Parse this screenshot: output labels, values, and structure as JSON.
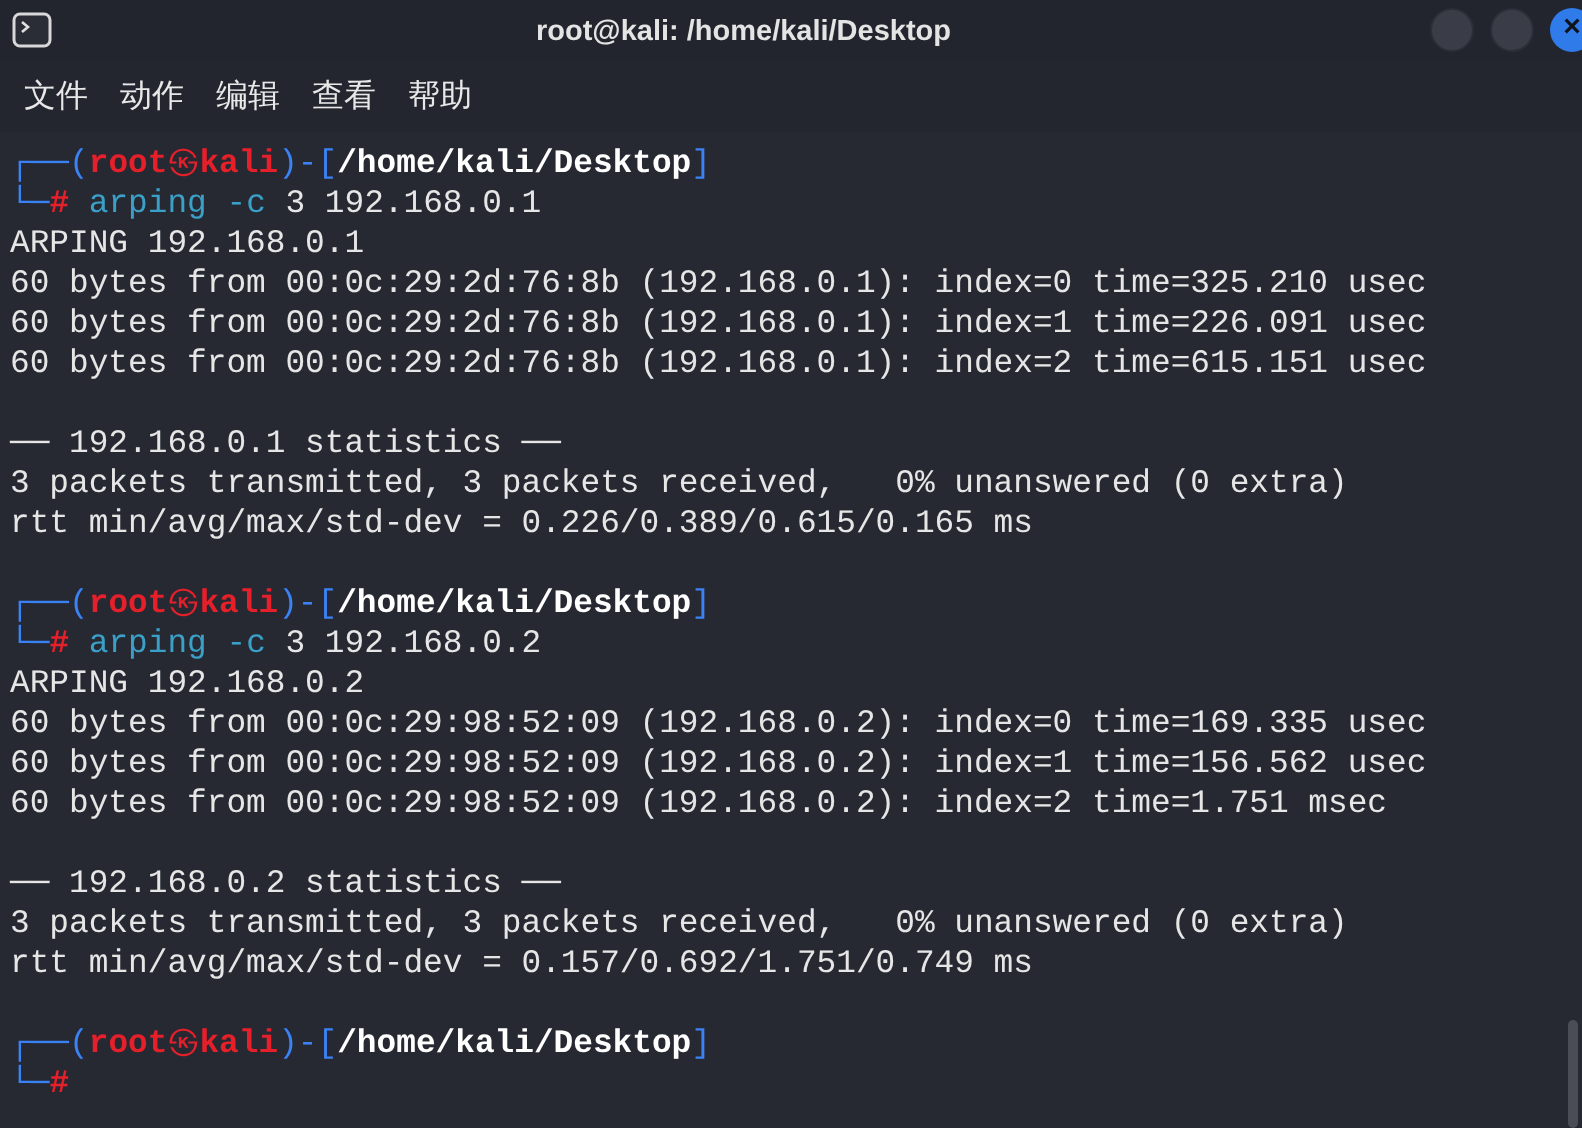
{
  "window": {
    "title": "root@kali: /home/kali/Desktop",
    "close": "×"
  },
  "menu": [
    "文件",
    "动作",
    "编辑",
    "查看",
    "帮助"
  ],
  "lines": [
    {
      "kind": "prompt",
      "open": "┌──(",
      "user": "root",
      "at": "㉿",
      "host": "kali",
      "mid": ")-[",
      "path": "/home/kali/Desktop",
      "close": "]"
    },
    {
      "kind": "command",
      "corner": "└─",
      "hash": "#",
      "program": "arping",
      "option": "-c",
      "args": "3 192.168.0.1"
    },
    {
      "kind": "output",
      "text": "ARPING 192.168.0.1"
    },
    {
      "kind": "output",
      "text": "60 bytes from 00:0c:29:2d:76:8b (192.168.0.1): index=0 time=325.210 usec"
    },
    {
      "kind": "output",
      "text": "60 bytes from 00:0c:29:2d:76:8b (192.168.0.1): index=1 time=226.091 usec"
    },
    {
      "kind": "output",
      "text": "60 bytes from 00:0c:29:2d:76:8b (192.168.0.1): index=2 time=615.151 usec"
    },
    {
      "kind": "blank"
    },
    {
      "kind": "output",
      "text": "── 192.168.0.1 statistics ──"
    },
    {
      "kind": "output",
      "text": "3 packets transmitted, 3 packets received,   0% unanswered (0 extra)"
    },
    {
      "kind": "output",
      "text": "rtt min/avg/max/std-dev = 0.226/0.389/0.615/0.165 ms"
    },
    {
      "kind": "blank"
    },
    {
      "kind": "prompt",
      "open": "┌──(",
      "user": "root",
      "at": "㉿",
      "host": "kali",
      "mid": ")-[",
      "path": "/home/kali/Desktop",
      "close": "]"
    },
    {
      "kind": "command",
      "corner": "└─",
      "hash": "#",
      "program": "arping",
      "option": "-c",
      "args": "3 192.168.0.2"
    },
    {
      "kind": "output",
      "text": "ARPING 192.168.0.2"
    },
    {
      "kind": "output",
      "text": "60 bytes from 00:0c:29:98:52:09 (192.168.0.2): index=0 time=169.335 usec"
    },
    {
      "kind": "output",
      "text": "60 bytes from 00:0c:29:98:52:09 (192.168.0.2): index=1 time=156.562 usec"
    },
    {
      "kind": "output",
      "text": "60 bytes from 00:0c:29:98:52:09 (192.168.0.2): index=2 time=1.751 msec"
    },
    {
      "kind": "blank"
    },
    {
      "kind": "output",
      "text": "── 192.168.0.2 statistics ──"
    },
    {
      "kind": "output",
      "text": "3 packets transmitted, 3 packets received,   0% unanswered (0 extra)"
    },
    {
      "kind": "output",
      "text": "rtt min/avg/max/std-dev = 0.157/0.692/1.751/0.749 ms"
    },
    {
      "kind": "blank"
    },
    {
      "kind": "prompt",
      "open": "┌──(",
      "user": "root",
      "at": "㉿",
      "host": "kali",
      "mid": ")-[",
      "path": "/home/kali/Desktop",
      "close": "]"
    },
    {
      "kind": "command",
      "corner": "└─",
      "hash": "#"
    }
  ]
}
